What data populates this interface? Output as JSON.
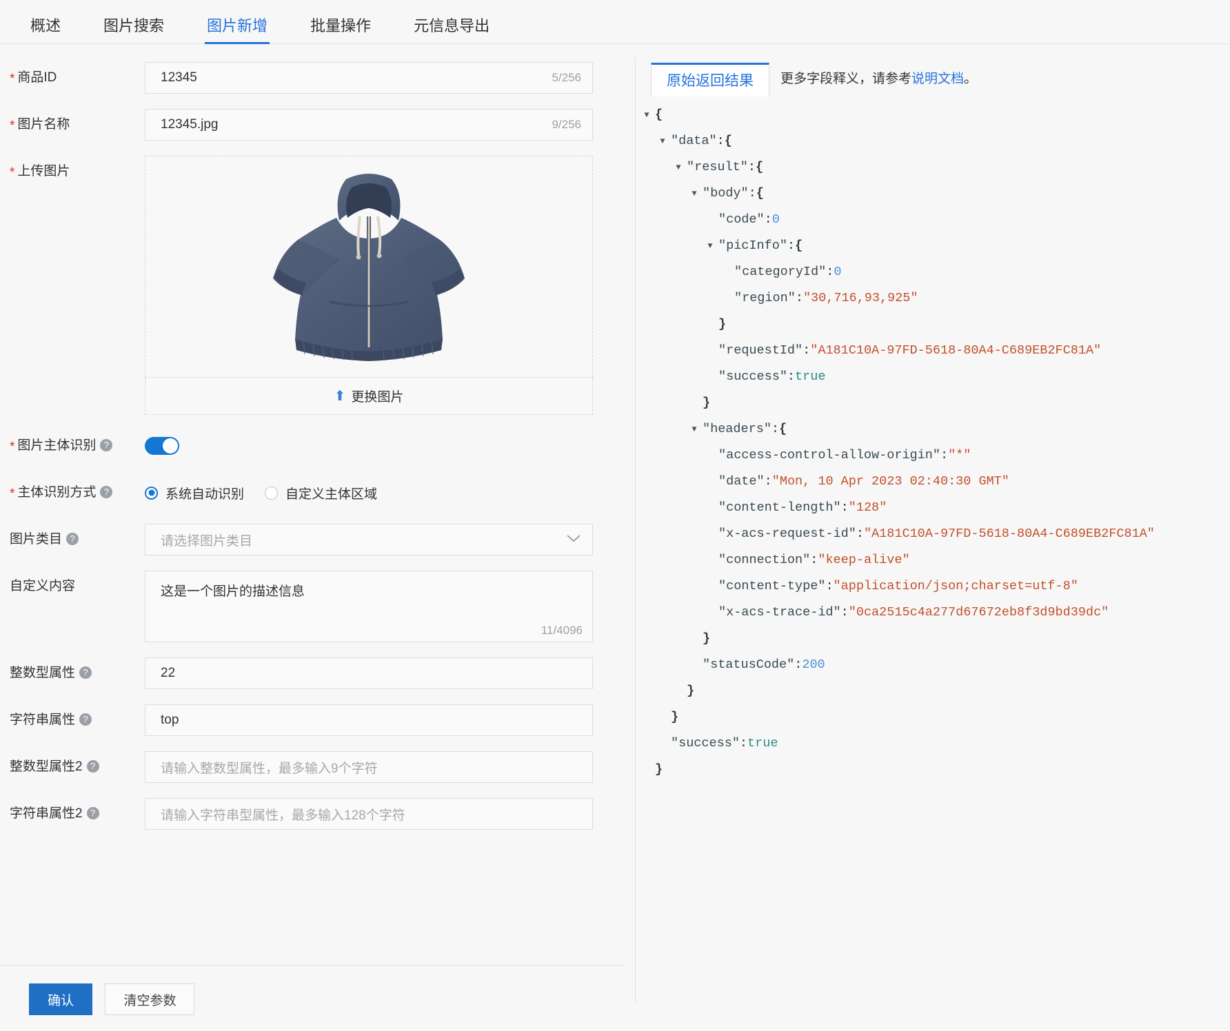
{
  "tabs": [
    {
      "label": "概述",
      "active": false
    },
    {
      "label": "图片搜索",
      "active": false
    },
    {
      "label": "图片新增",
      "active": true
    },
    {
      "label": "批量操作",
      "active": false
    },
    {
      "label": "元信息导出",
      "active": false
    }
  ],
  "form": {
    "product_id": {
      "label": "商品ID",
      "value": "12345",
      "counter": "5/256",
      "required": true
    },
    "image_name": {
      "label": "图片名称",
      "value": "12345.jpg",
      "counter": "9/256",
      "required": true
    },
    "upload": {
      "label": "上传图片",
      "required": true,
      "replace_label": "更换图片",
      "icon": "upload-icon"
    },
    "subject_detect": {
      "label": "图片主体识别",
      "required": true,
      "on": true,
      "help": "help-icon"
    },
    "detect_mode": {
      "label": "主体识别方式",
      "required": true,
      "help": "help-icon",
      "options": [
        {
          "label": "系统自动识别",
          "selected": true
        },
        {
          "label": "自定义主体区域",
          "selected": false
        }
      ]
    },
    "category": {
      "label": "图片类目",
      "placeholder": "请选择图片类目",
      "value": "",
      "help": "help-icon",
      "chevron": "chevron-down-icon"
    },
    "custom_content": {
      "label": "自定义内容",
      "value": "这是一个图片的描述信息",
      "counter": "11/4096"
    },
    "int_attr": {
      "label": "整数型属性",
      "value": "22",
      "help": "help-icon"
    },
    "str_attr": {
      "label": "字符串属性",
      "value": "top",
      "help": "help-icon"
    },
    "int_attr2": {
      "label": "整数型属性2",
      "value": "",
      "placeholder": "请输入整数型属性，最多输入9个字符",
      "help": "help-icon"
    },
    "str_attr2": {
      "label": "字符串属性2",
      "value": "",
      "placeholder": "请输入字符串型属性，最多输入128个字符",
      "help": "help-icon"
    }
  },
  "footer": {
    "confirm_label": "确认",
    "clear_label": "清空参数"
  },
  "result_panel": {
    "tab_label": "原始返回结果",
    "note_prefix": "更多字段释义，请参考",
    "note_link": "说明文档",
    "note_suffix": "。",
    "json_lines": [
      {
        "indent": 0,
        "arrow": "open",
        "text": "{",
        "cls": "br"
      },
      {
        "indent": 1,
        "arrow": "open",
        "key": "\"data\"",
        "sep": " : ",
        "text": "{",
        "cls": "br"
      },
      {
        "indent": 2,
        "arrow": "open",
        "key": "\"result\"",
        "sep": " : ",
        "text": "{",
        "cls": "br"
      },
      {
        "indent": 3,
        "arrow": "open",
        "key": "\"body\"",
        "sep": " : ",
        "text": "{",
        "cls": "br"
      },
      {
        "indent": 4,
        "arrow": "none",
        "key": "\"code\"",
        "sep": " : ",
        "text": "0",
        "cls": "n"
      },
      {
        "indent": 4,
        "arrow": "open",
        "key": "\"picInfo\"",
        "sep": " : ",
        "text": "{",
        "cls": "br"
      },
      {
        "indent": 5,
        "arrow": "none",
        "key": "\"categoryId\"",
        "sep": " : ",
        "text": "0",
        "cls": "n"
      },
      {
        "indent": 5,
        "arrow": "none",
        "key": "\"region\"",
        "sep": " : ",
        "text": "\"30,716,93,925\"",
        "cls": "s"
      },
      {
        "indent": 4,
        "arrow": "none",
        "text": "}",
        "cls": "br"
      },
      {
        "indent": 4,
        "arrow": "none",
        "key": "\"requestId\"",
        "sep": " : ",
        "text": "\"A181C10A-97FD-5618-80A4-C689EB2FC81A\"",
        "cls": "s"
      },
      {
        "indent": 4,
        "arrow": "none",
        "key": "\"success\"",
        "sep": " : ",
        "text": "true",
        "cls": "b"
      },
      {
        "indent": 3,
        "arrow": "none",
        "text": "}",
        "cls": "br"
      },
      {
        "indent": 3,
        "arrow": "open",
        "key": "\"headers\"",
        "sep": " : ",
        "text": "{",
        "cls": "br"
      },
      {
        "indent": 4,
        "arrow": "none",
        "key": "\"access-control-allow-origin\"",
        "sep": " : ",
        "text": "\"*\"",
        "cls": "s"
      },
      {
        "indent": 4,
        "arrow": "none",
        "key": "\"date\"",
        "sep": " : ",
        "text": "\"Mon, 10 Apr 2023 02:40:30 GMT\"",
        "cls": "s"
      },
      {
        "indent": 4,
        "arrow": "none",
        "key": "\"content-length\"",
        "sep": " : ",
        "text": "\"128\"",
        "cls": "s"
      },
      {
        "indent": 4,
        "arrow": "none",
        "key": "\"x-acs-request-id\"",
        "sep": " : ",
        "text": "\"A181C10A-97FD-5618-80A4-C689EB2FC81A\"",
        "cls": "s"
      },
      {
        "indent": 4,
        "arrow": "none",
        "key": "\"connection\"",
        "sep": " : ",
        "text": "\"keep-alive\"",
        "cls": "s"
      },
      {
        "indent": 4,
        "arrow": "none",
        "key": "\"content-type\"",
        "sep": " : ",
        "text": "\"application/json;charset=utf-8\"",
        "cls": "s"
      },
      {
        "indent": 4,
        "arrow": "none",
        "key": "\"x-acs-trace-id\"",
        "sep": " : ",
        "text": "\"0ca2515c4a277d67672eb8f3d9bd39dc\"",
        "cls": "s"
      },
      {
        "indent": 3,
        "arrow": "none",
        "text": "}",
        "cls": "br"
      },
      {
        "indent": 3,
        "arrow": "none",
        "key": "\"statusCode\"",
        "sep": " : ",
        "text": "200",
        "cls": "n"
      },
      {
        "indent": 2,
        "arrow": "none",
        "text": "}",
        "cls": "br"
      },
      {
        "indent": 1,
        "arrow": "none",
        "text": "}",
        "cls": "br"
      },
      {
        "indent": 1,
        "arrow": "none",
        "key": "\"success\"",
        "sep": " : ",
        "text": "true",
        "cls": "b"
      },
      {
        "indent": 0,
        "arrow": "none",
        "text": "}",
        "cls": "br"
      }
    ]
  },
  "colors": {
    "accent": "#2673dd",
    "primary_button": "#1f6fc4",
    "required_star": "#d93026",
    "switch_on": "#1677d2",
    "json_string": "#c3502a",
    "json_number": "#4a90d9",
    "json_bool": "#2c8a82"
  }
}
